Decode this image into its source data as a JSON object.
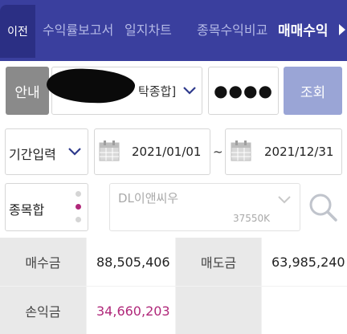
{
  "topnav": {
    "back_label": "이전",
    "tabs": [
      "수익률보고서",
      "일지차트",
      "종목수익비교",
      "매매수익"
    ],
    "active_tab": "매매수익"
  },
  "account": {
    "guide_label": "안내",
    "account_suffix": "탁종합]",
    "password_mask": "●●●●",
    "query_label": "조회"
  },
  "period": {
    "mode_label": "기간입력",
    "start_date": "2021/01/01",
    "separator": "~",
    "end_date": "2021/12/31"
  },
  "stock": {
    "type_label": "종목합",
    "name_placeholder": "DL이앤씨우",
    "code": "37550K"
  },
  "summary": {
    "buy_label": "매수금",
    "buy_value": "88,505,406",
    "sell_label": "매도금",
    "sell_value": "63,985,240",
    "pnl_label": "손익금",
    "pnl_value": "34,660,203"
  },
  "colors": {
    "nav_bg": "#3a3f9e",
    "query_button": "#9aa5d6",
    "profit_text": "#b0287a"
  }
}
